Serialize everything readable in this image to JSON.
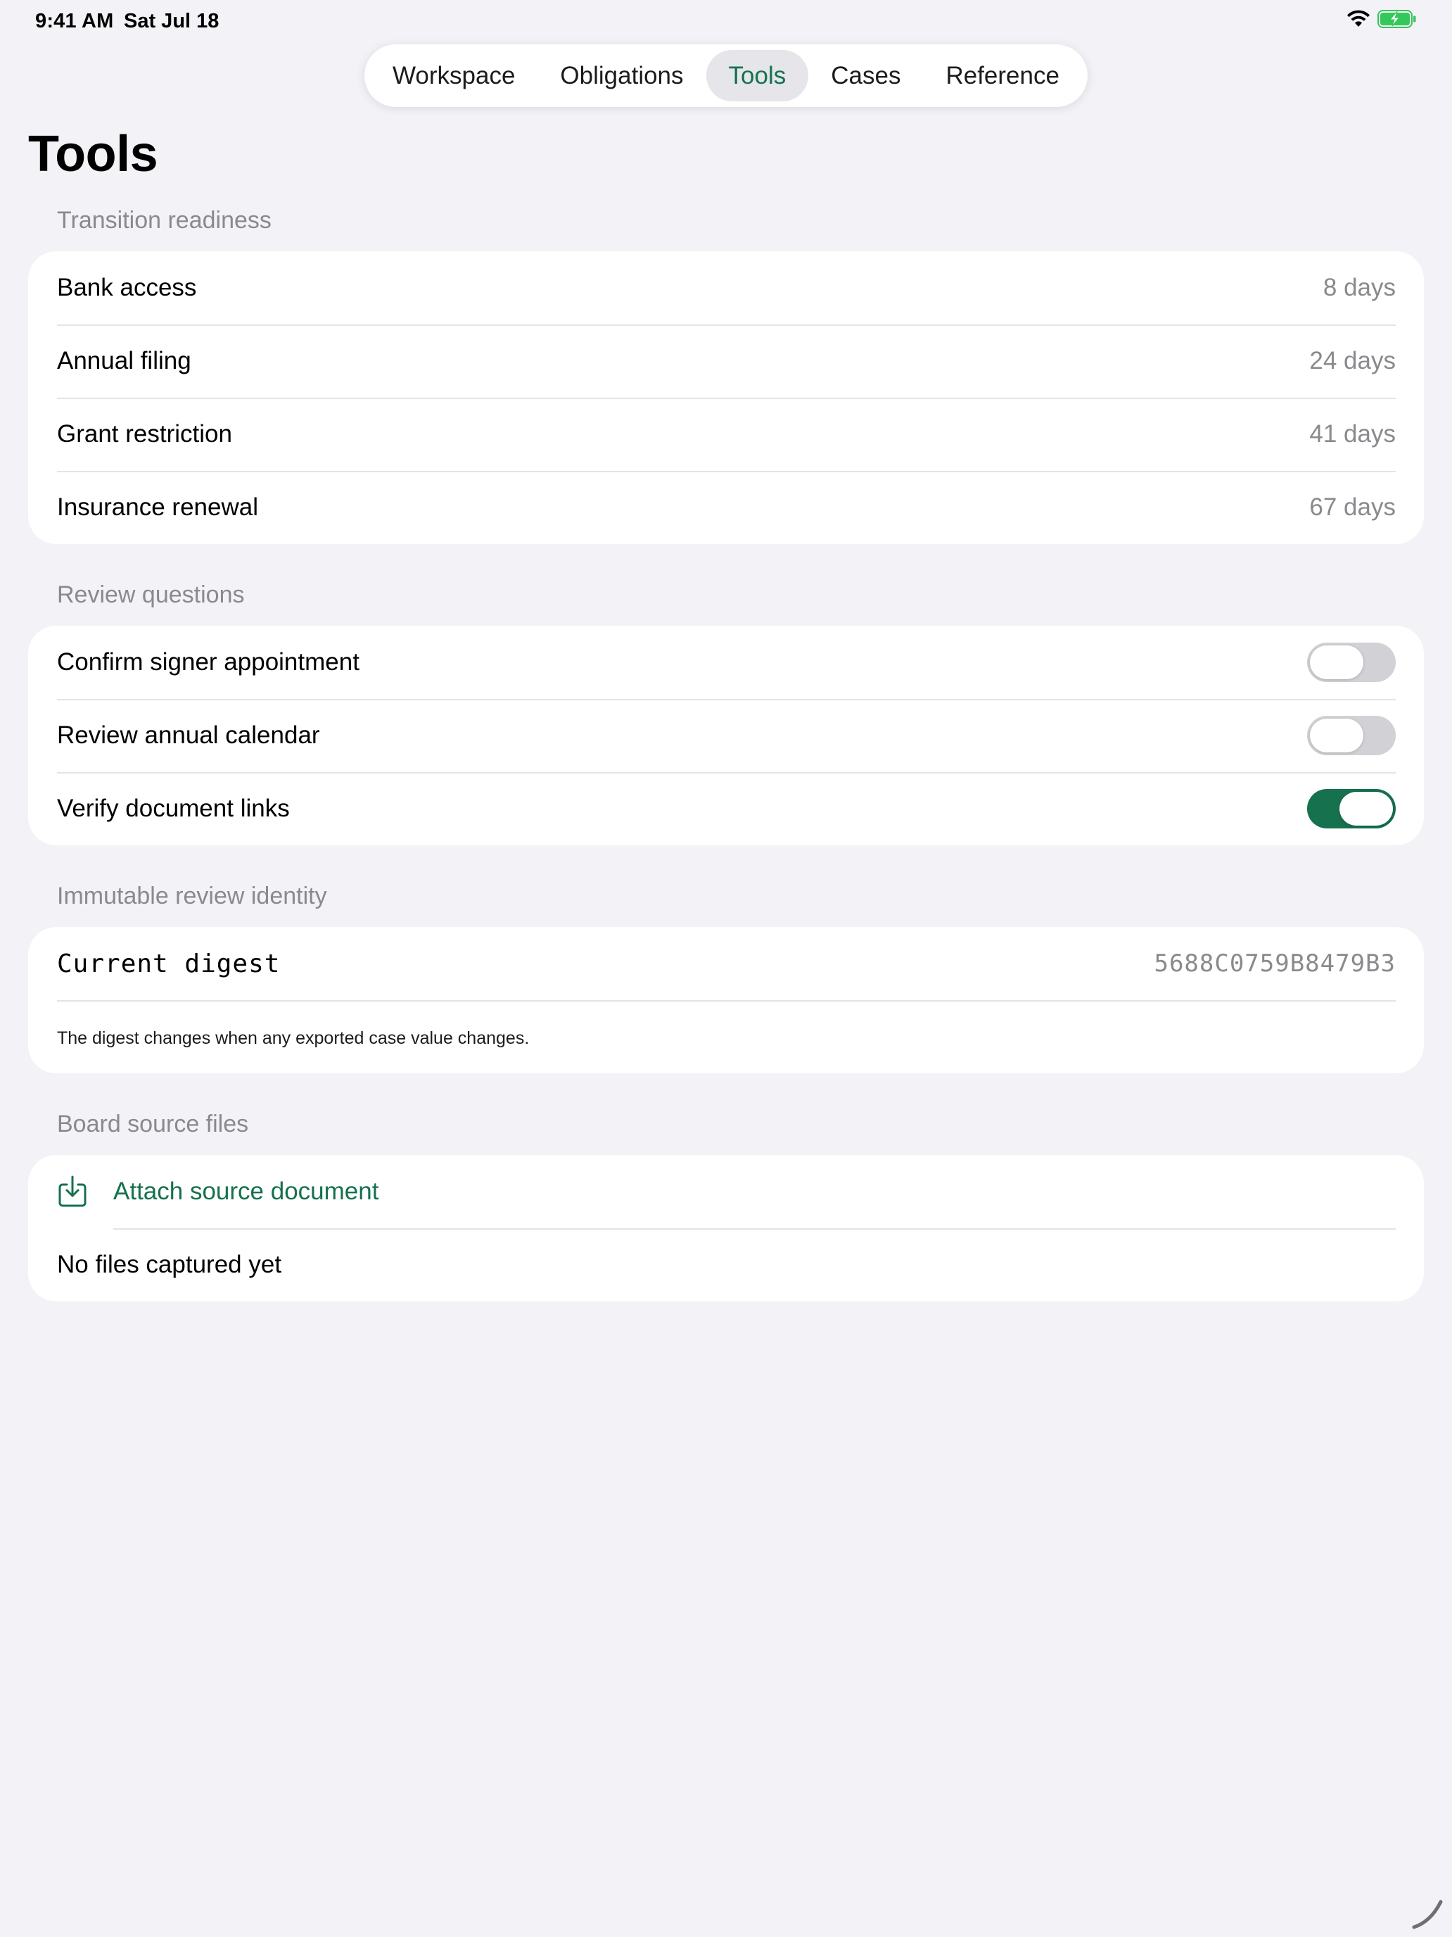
{
  "status_bar": {
    "time": "9:41 AM",
    "date": "Sat Jul 18",
    "icons": [
      "wifi-icon",
      "battery-charging-icon"
    ]
  },
  "tabs": [
    {
      "label": "Workspace",
      "active": false
    },
    {
      "label": "Obligations",
      "active": false
    },
    {
      "label": "Tools",
      "active": true
    },
    {
      "label": "Cases",
      "active": false
    },
    {
      "label": "Reference",
      "active": false
    }
  ],
  "page": {
    "title": "Tools"
  },
  "transition_readiness": {
    "header": "Transition readiness",
    "items": [
      {
        "label": "Bank access",
        "value": "8 days"
      },
      {
        "label": "Annual filing",
        "value": "24 days"
      },
      {
        "label": "Grant restriction",
        "value": "41 days"
      },
      {
        "label": "Insurance renewal",
        "value": "67 days"
      }
    ]
  },
  "review_questions": {
    "header": "Review questions",
    "items": [
      {
        "label": "Confirm signer appointment",
        "on": false
      },
      {
        "label": "Review annual calendar",
        "on": false
      },
      {
        "label": "Verify document links",
        "on": true
      }
    ]
  },
  "review_identity": {
    "header": "Immutable review identity",
    "label": "Current digest",
    "value": "5688C0759B8479B3",
    "footnote": "The digest changes when any exported case value changes."
  },
  "source_files": {
    "header": "Board source files",
    "attach_label": "Attach source document",
    "empty_label": "No files captured yet"
  },
  "colors": {
    "accent": "#15714e",
    "background": "#f2f2f7",
    "card": "#ffffff",
    "secondary_text": "#8a8a8e",
    "toggle_off": "#d1d1d6",
    "battery": "#34c759"
  }
}
